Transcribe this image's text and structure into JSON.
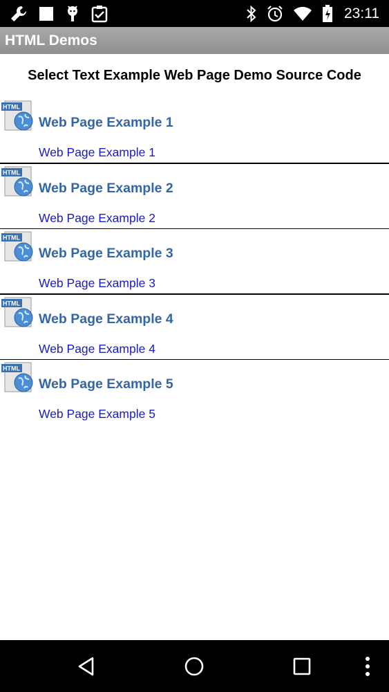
{
  "status_bar": {
    "time": "23:11",
    "left_icons": [
      "wrench-icon",
      "square-icon",
      "android-icon",
      "clipboard-check-icon"
    ],
    "right_icons": [
      "bluetooth-icon",
      "alarm-icon",
      "wifi-icon",
      "battery-icon"
    ]
  },
  "action_bar": {
    "title": "HTML Demos"
  },
  "page": {
    "heading": "Select Text Example Web Page Demo Source Code",
    "items": [
      {
        "title": "Web Page Example 1",
        "link": "Web Page Example 1"
      },
      {
        "title": "Web Page Example 2",
        "link": "Web Page Example 2"
      },
      {
        "title": "Web Page Example 3",
        "link": "Web Page Example 3"
      },
      {
        "title": "Web Page Example 4",
        "link": "Web Page Example 4"
      },
      {
        "title": "Web Page Example 5",
        "link": "Web Page Example 5"
      }
    ],
    "item_icon_label": "HTML"
  },
  "nav_bar": {
    "buttons": [
      "back-icon",
      "home-icon",
      "recents-icon",
      "overflow-menu-icon"
    ]
  },
  "colors": {
    "title_blue": "#3465a4",
    "link_blue": "#1a1ac8",
    "action_bar": "#9e9e9e"
  }
}
